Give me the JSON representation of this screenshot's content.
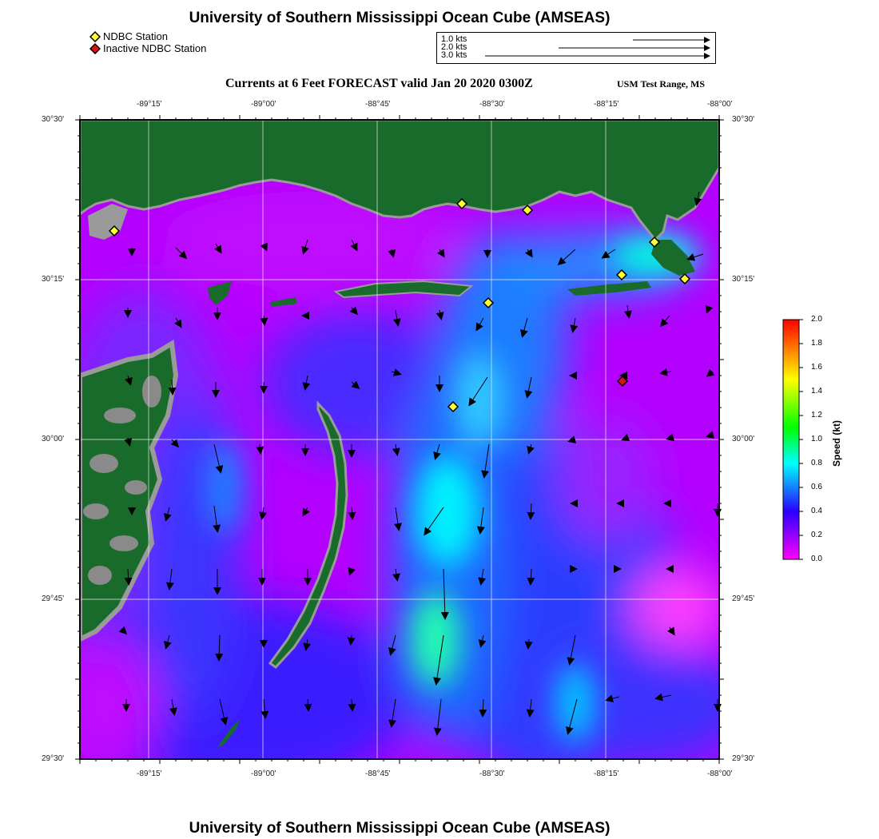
{
  "header": {
    "title": "University of Southern Mississippi Ocean Cube (AMSEAS)",
    "subtitle": "Currents at 6 Feet FORECAST  valid Jan 20 2020 0300Z",
    "region": "USM Test Range, MS"
  },
  "footer": {
    "title": "University of Southern Mississippi Ocean Cube (AMSEAS)"
  },
  "legend": {
    "station_active": "NDBC Station",
    "station_inactive": "Inactive NDBC Station",
    "active_color": "#ffff33",
    "inactive_color": "#dd1111"
  },
  "reference_vectors": [
    {
      "label": "1.0 kts"
    },
    {
      "label": "2.0 kts"
    },
    {
      "label": "3.0 kts"
    }
  ],
  "axes": {
    "lon_ticks": [
      "-89°15'",
      "-89°00'",
      "-88°45'",
      "-88°30'",
      "-88°15'",
      "-88°00'"
    ],
    "lat_ticks_left": [
      "30°30'",
      "30°15'",
      "30°00'",
      "29°45'",
      "29°30'"
    ],
    "lat_ticks_right": [
      "30°30'",
      "30°15'",
      "30°00'",
      "29°45'",
      "29°30'"
    ]
  },
  "colorbar": {
    "title": "Speed (kt)",
    "ticks": [
      "2.0",
      "1.8",
      "1.6",
      "1.4",
      "1.2",
      "1.0",
      "0.8",
      "0.6",
      "0.4",
      "0.2",
      "0.0"
    ],
    "colors": [
      "#ff00ff",
      "#2200ff",
      "#00ffff",
      "#00ff00",
      "#ffff00",
      "#ff0000"
    ]
  },
  "colors": {
    "land": "#186b2a",
    "ocean_low": "#b400ff",
    "ocean_mid": "#2a3cff",
    "ocean_high": "#00f0e8"
  }
}
